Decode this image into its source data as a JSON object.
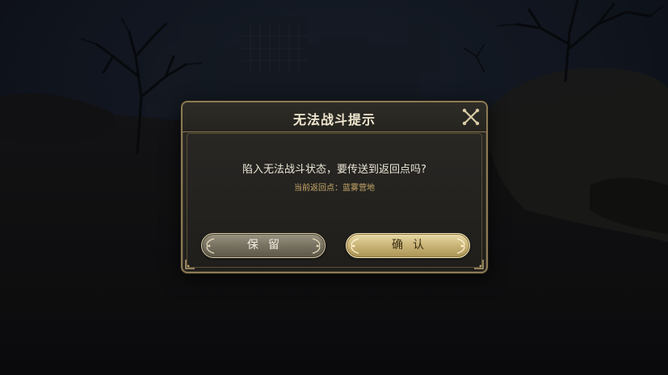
{
  "dialog": {
    "title": "无法战斗提示",
    "message": "陷入无法战斗状态，要传送到返回点吗?",
    "sub_message": "当前返回点：蓝雾营地",
    "close_icon": "close-x-icon"
  },
  "buttons": {
    "keep_label": "保留",
    "confirm_label": "确认"
  },
  "colors": {
    "frame_gold": "#8c7a55",
    "title_text": "#efe6cf",
    "sub_message": "#c9a96a",
    "confirm_button": "#cdb77a",
    "keep_button": "#7b7565"
  }
}
